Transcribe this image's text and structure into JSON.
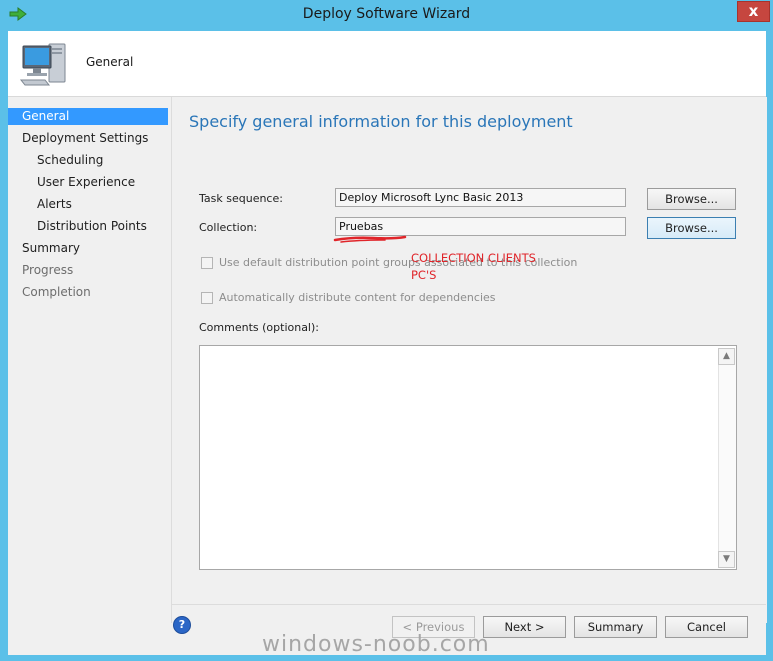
{
  "window": {
    "title": "Deploy Software Wizard",
    "close_glyph": "x"
  },
  "header": {
    "page_title": "General"
  },
  "nav": {
    "items": [
      {
        "label": "General"
      },
      {
        "label": "Deployment Settings"
      },
      {
        "label": "Scheduling"
      },
      {
        "label": "User Experience"
      },
      {
        "label": "Alerts"
      },
      {
        "label": "Distribution Points"
      },
      {
        "label": "Summary"
      },
      {
        "label": "Progress"
      },
      {
        "label": "Completion"
      }
    ],
    "selected": "General"
  },
  "main": {
    "heading": "Specify general information for this deployment",
    "task_sequence": {
      "label": "Task sequence:",
      "value": "Deploy Microsoft Lync  Basic 2013",
      "browse_label": "Browse..."
    },
    "collection": {
      "label": "Collection:",
      "value": "Pruebas",
      "browse_label": "Browse..."
    },
    "checkboxes": [
      {
        "label": "Use default distribution point groups associated to this collection",
        "checked": false,
        "enabled": false
      },
      {
        "label": "Automatically distribute content for dependencies",
        "checked": false,
        "enabled": false
      }
    ],
    "comments": {
      "label": "Comments (optional):",
      "value": ""
    }
  },
  "annotation": {
    "line1": "COLLECTION CLIENTS",
    "line2": "PC'S",
    "color": "#e0252a"
  },
  "footer": {
    "help_glyph": "?",
    "previous_label": "< Previous",
    "next_label": "Next >",
    "summary_label": "Summary",
    "cancel_label": "Cancel"
  },
  "watermark": "windows-noob.com",
  "colors": {
    "accent": "#3399ff",
    "heading": "#2a76b8",
    "frame": "#5bc0e8"
  },
  "icons": {
    "app": "green-arrow-icon",
    "header": "computer-icon",
    "scroll_up": "chevron-up-icon",
    "scroll_down": "chevron-down-icon"
  }
}
